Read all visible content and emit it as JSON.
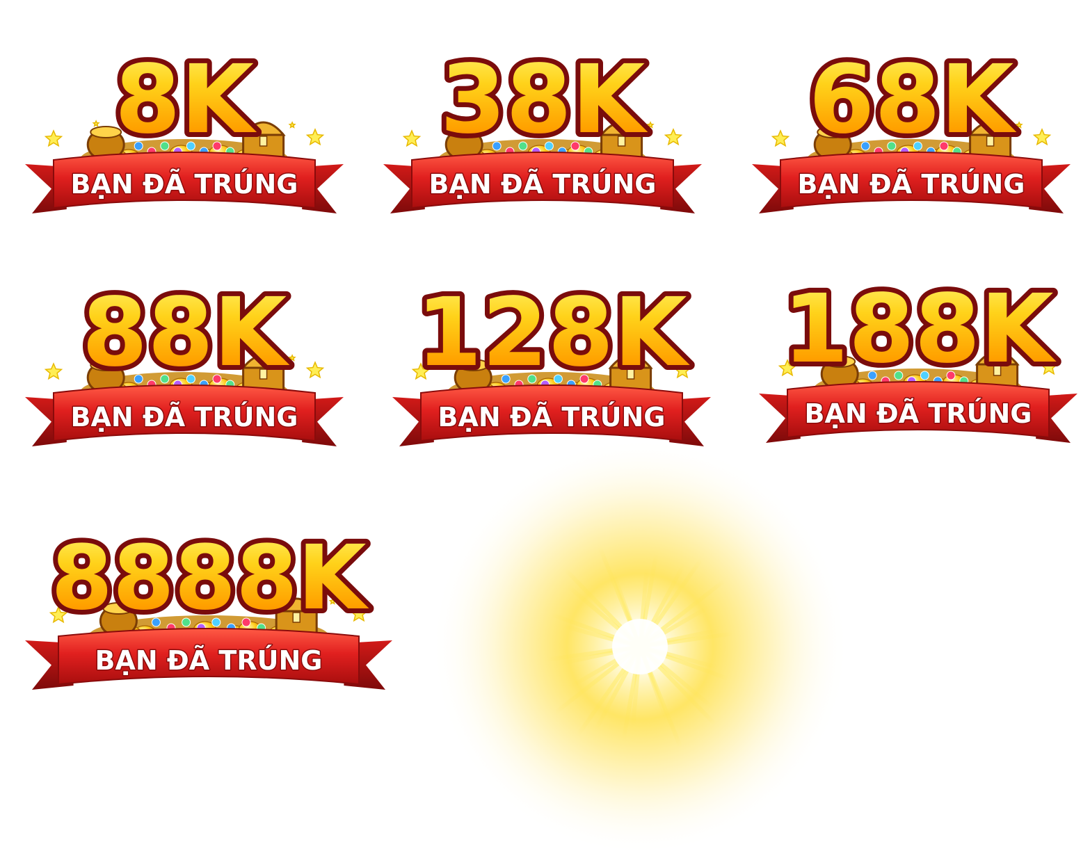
{
  "colors": {
    "gold_top": "#ffe23a",
    "gold_mid": "#ffb300",
    "gold_bottom": "#ff7a00",
    "number_outline": "#7a0c0c",
    "ribbon_red": "#e1201f",
    "ribbon_dark": "#9c0d0d",
    "ribbon_highlight": "#ff4b3a",
    "flare_yellow": "#ffe14a"
  },
  "badges": [
    {
      "amount": "8K",
      "label": "BẠN ĐÃ TRÚNG"
    },
    {
      "amount": "38K",
      "label": "BẠN ĐÃ TRÚNG"
    },
    {
      "amount": "68K",
      "label": "BẠN ĐÃ TRÚNG"
    },
    {
      "amount": "88K",
      "label": "BẠN ĐÃ TRÚNG"
    },
    {
      "amount": "128K",
      "label": "BẠN ĐÃ TRÚNG"
    },
    {
      "amount": "188K",
      "label": "BẠN ĐÃ TRÚNG"
    },
    {
      "amount": "8888K",
      "label": "BẠN ĐÃ TRÚNG"
    }
  ],
  "flare": {
    "icon": "light-burst-icon"
  }
}
